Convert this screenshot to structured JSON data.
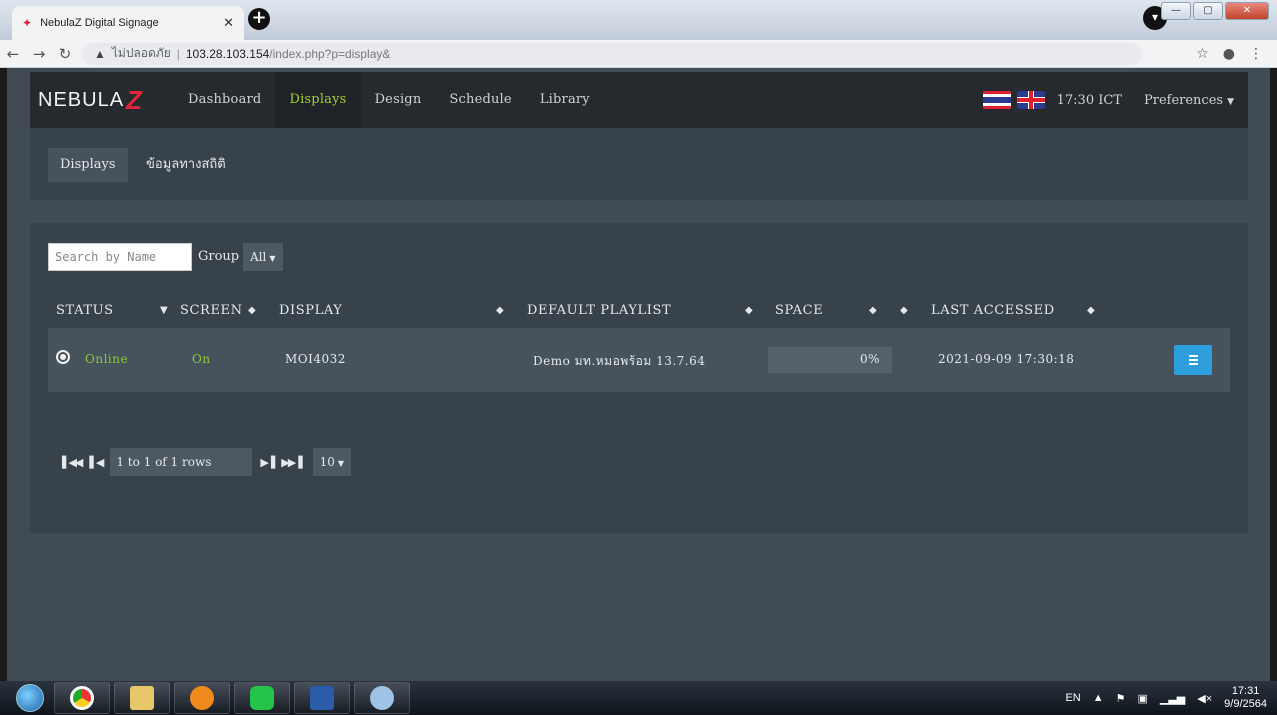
{
  "browser": {
    "tab_title": "NebulaZ Digital Signage",
    "insecure_label": "ไม่ปลอดภัย",
    "url_host": "103.28.103.154",
    "url_path": "/index.php?p=display&"
  },
  "navbar": {
    "logo_text": "NEBULA",
    "logo_z": "Z",
    "items": [
      {
        "label": "Dashboard"
      },
      {
        "label": "Displays",
        "active": true
      },
      {
        "label": "Design"
      },
      {
        "label": "Schedule"
      },
      {
        "label": "Library"
      }
    ],
    "time": "17:30 ICT",
    "preferences": "Preferences"
  },
  "subnav": {
    "items": [
      {
        "label": "Displays",
        "active": true
      },
      {
        "label": "ข้อมูลทางสถิติ"
      }
    ]
  },
  "filters": {
    "search_placeholder": "Search by Name",
    "group_label": "Group",
    "group_value": "All"
  },
  "table": {
    "headers": {
      "status": "STATUS",
      "screen": "SCREEN",
      "display": "DISPLAY",
      "default_playlist": "DEFAULT PLAYLIST",
      "space": "SPACE",
      "last_accessed": "LAST ACCESSED"
    },
    "rows": [
      {
        "status": "Online",
        "screen": "On",
        "display": "MOI4032",
        "default_playlist": "Demo มท.หมอพร้อม 13.7.64",
        "space": "0%",
        "last_accessed": "2021-09-09 17:30:18"
      }
    ]
  },
  "pagination": {
    "info": "1 to 1 of 1 rows",
    "page_size": "10"
  },
  "taskbar": {
    "lang": "EN",
    "time": "17:31",
    "date": "9/9/2564"
  },
  "colors": {
    "accent_green": "#8ec63f",
    "active_nav": "#a4cf30",
    "brand_red": "#e0263a",
    "action_blue": "#2d9fdc"
  }
}
